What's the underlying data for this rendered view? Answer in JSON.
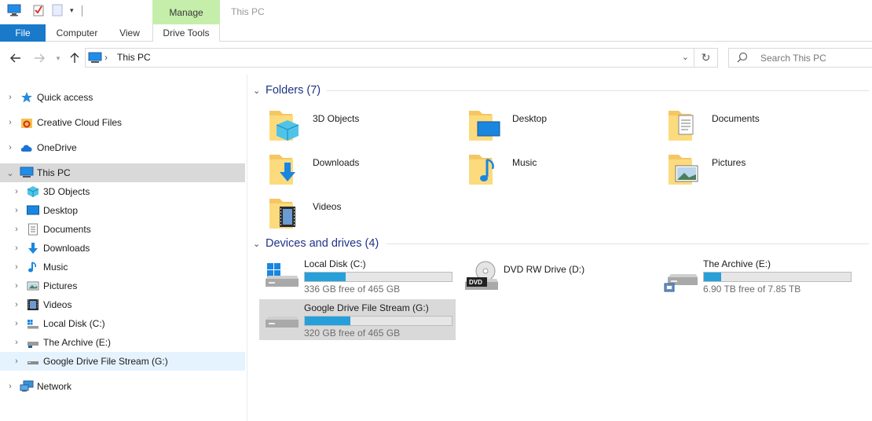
{
  "window": {
    "title": "This PC",
    "context_tab": "Manage"
  },
  "ribbon": {
    "tabs": [
      "File",
      "Computer",
      "View",
      "Drive Tools"
    ]
  },
  "address": {
    "path": "This PC",
    "search_placeholder": "Search This PC"
  },
  "nav": {
    "quick_access": "Quick access",
    "creative_cloud": "Creative Cloud Files",
    "onedrive": "OneDrive",
    "this_pc": "This PC",
    "items": [
      "3D Objects",
      "Desktop",
      "Documents",
      "Downloads",
      "Music",
      "Pictures",
      "Videos",
      "Local Disk (C:)",
      "The Archive (E:)",
      "Google Drive File Stream (G:)"
    ],
    "network": "Network"
  },
  "content": {
    "folders_header": "Folders (7)",
    "folders": [
      "3D Objects",
      "Desktop",
      "Documents",
      "Downloads",
      "Music",
      "Pictures",
      "Videos"
    ],
    "drives_header": "Devices and drives (4)",
    "drives": [
      {
        "name": "Local Disk (C:)",
        "free": "336 GB free of 465 GB",
        "used_fraction": 0.28
      },
      {
        "name": "DVD RW Drive (D:)"
      },
      {
        "name": "The Archive (E:)",
        "free": "6.90 TB free of 7.85 TB",
        "used_fraction": 0.12
      },
      {
        "name": "Google Drive File Stream (G:)",
        "free": "320 GB free of 465 GB",
        "used_fraction": 0.31
      }
    ]
  },
  "colors": {
    "accent": "#1979ca",
    "manage_tab": "#c5eeaa",
    "header_text": "#1e3287",
    "bar_fill": "#26a0da",
    "selection": "#d9d9d9"
  }
}
